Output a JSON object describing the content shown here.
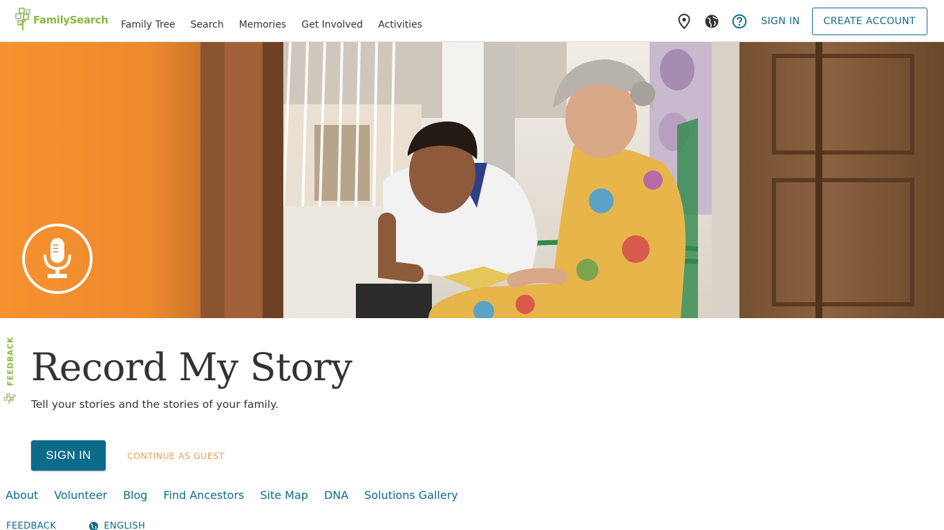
{
  "header": {
    "logo_text": "FamilySearch",
    "nav": [
      {
        "label": "Family Tree"
      },
      {
        "label": "Search"
      },
      {
        "label": "Memories"
      },
      {
        "label": "Get Involved"
      },
      {
        "label": "Activities"
      }
    ],
    "icons": [
      "location-pin-icon",
      "globe-icon",
      "help-icon"
    ],
    "sign_in_label": "SIGN IN",
    "create_account_label": "CREATE ACCOUNT"
  },
  "hero": {
    "badge_icon": "microphone-icon"
  },
  "feedback_tab": {
    "label": "FEEDBACK"
  },
  "main": {
    "title": "Record My Story",
    "subtitle": "Tell your stories and the stories of your family.",
    "sign_in_button": "SIGN IN",
    "guest_link": "CONTINUE AS GUEST"
  },
  "footer": {
    "links": [
      {
        "label": "About"
      },
      {
        "label": "Volunteer"
      },
      {
        "label": "Blog"
      },
      {
        "label": "Find Ancestors"
      },
      {
        "label": "Site Map"
      },
      {
        "label": "DNA"
      },
      {
        "label": "Solutions Gallery"
      }
    ],
    "feedback_label": "FEEDBACK",
    "language_label": "ENGLISH"
  },
  "colors": {
    "brand_green": "#87b940",
    "primary_blue": "#0c6b8a",
    "hero_orange": "#f6922f",
    "guest_link_orange": "#e39d58",
    "text_dark": "#333331"
  }
}
